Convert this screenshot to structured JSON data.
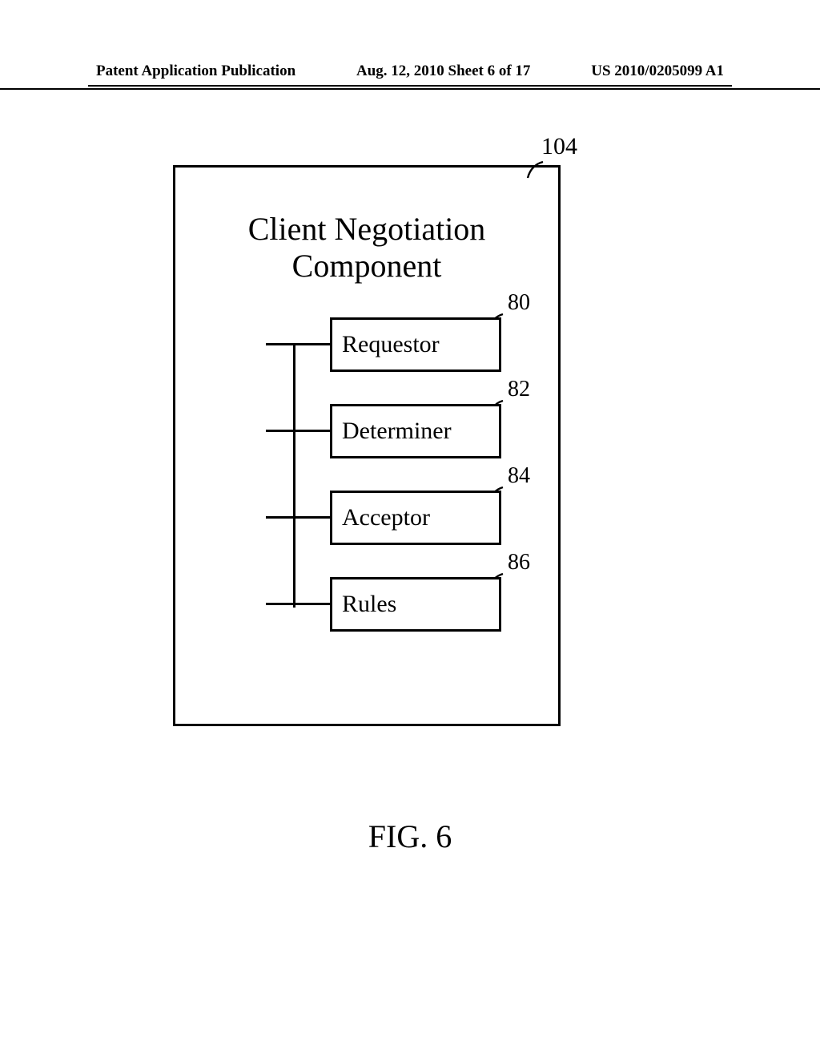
{
  "header": {
    "left": "Patent Application Publication",
    "middle": "Aug. 12, 2010  Sheet 6 of 17",
    "right": "US 2010/0205099 A1"
  },
  "diagram": {
    "title_line1": "Client Negotiation",
    "title_line2": "Component",
    "outer_ref": "104",
    "blocks": [
      {
        "label": "Requestor",
        "ref": "80"
      },
      {
        "label": "Determiner",
        "ref": "82"
      },
      {
        "label": "Acceptor",
        "ref": "84"
      },
      {
        "label": "Rules",
        "ref": "86"
      }
    ]
  },
  "figure_caption": "FIG. 6"
}
